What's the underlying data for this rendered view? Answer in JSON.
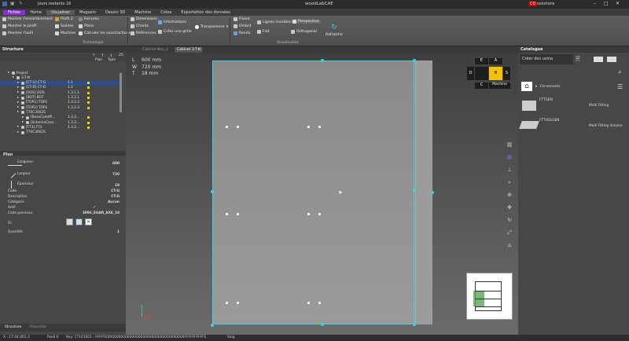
{
  "app": {
    "title": "woodLabCAE",
    "days_left": "Jours restants 16",
    "brand": "solutions",
    "brand_prefix": "CO"
  },
  "tabs": [
    "Fichier",
    "Home",
    "Visualiser",
    "Magasin",
    "Dessin 3D",
    "Machine",
    "Cotes",
    "Exportation des données"
  ],
  "ribbon": {
    "show_env": "Montrer l'encombrement",
    "show_profile": "Montrer le profil",
    "show_tool": "Montrer l'outil",
    "profil2": "Profil 2",
    "solides": "Solides",
    "machine": "Machine",
    "ferrures": "Ferrures",
    "plans": "Plans",
    "calc": "Calculer les soustractions",
    "group_tech": "Technologie",
    "dimensions": "Dimensions",
    "chants": "Chants",
    "references": "Références",
    "informations": "Informations",
    "creer_grille": "Créer une grille",
    "transparence": "Transparence",
    "filaire": "Filaire",
    "ombre": "Ombré",
    "rendu": "Rendu",
    "lignes_inv": "Lignes invisibles",
    "flat": "Flat",
    "perspective": "Perspective",
    "orthogonal": "Orthogonal",
    "group_vis": "Visualisation",
    "rafraichir": "Rafraîchir"
  },
  "structure": {
    "title": "Structure",
    "col_plan": "Plan",
    "col_type": "Type",
    "count": "25",
    "rows": [
      {
        "label": "Project",
        "plan": "",
        "indent": 0
      },
      {
        "label": "3-T-N",
        "plan": "",
        "indent": 1
      },
      {
        "label": "[CT-G] CT-G",
        "plan": "1.1",
        "indent": 2
      },
      {
        "label": "[CT-D] CT-D",
        "plan": "1.2",
        "indent": 2
      },
      {
        "label": "[DOS] DOS",
        "plan": "1.3.1.1",
        "indent": 2
      },
      {
        "label": "[BOT] BOT",
        "plan": "1.3.2.1",
        "indent": 2
      },
      {
        "label": "[TOP1] TOP1",
        "plan": "1.3.2.2",
        "indent": 2
      },
      {
        "label": "[TOP2] TOP2",
        "plan": "1.3.2.3",
        "indent": 2
      },
      {
        "label": "770C3002S",
        "plan": "",
        "indent": 2
      },
      {
        "label": "[BaseCoeeffi...",
        "plan": "1.3.2...",
        "indent": 3
      },
      {
        "label": "[SchemaCass...",
        "plan": "1.3.2...",
        "indent": 3
      },
      {
        "label": "[FT3] FT3",
        "plan": "1.3.2...",
        "indent": 2
      },
      {
        "label": "770C3002S",
        "plan": "",
        "indent": 2
      }
    ]
  },
  "properties": {
    "section": "Plan",
    "longueur": "Longueur",
    "longueur_val": "600",
    "largeur": "Largeur",
    "largeur_val": "720",
    "epaisseur": "Épaisseur",
    "epaisseur_val": "18",
    "code": "Code",
    "code_val": "CT-G",
    "description": "Description",
    "description_val": "CT-G",
    "categorie": "Catégorie",
    "categorie_val": "Aucun",
    "actif": "Actif",
    "actif_val": "✓",
    "code_panneau": "Code panneau",
    "code_panneau_val": "3096_EGAR_AXE_18",
    "fil": "Fil",
    "quantite": "Quantité",
    "quantite_val": "1"
  },
  "left_tabs": [
    "Structure",
    "Propriété"
  ],
  "viewport": {
    "tabs": [
      "Cabinet Neu_1",
      "Cabinet 3-T-N"
    ],
    "dims": [
      {
        "k": "L",
        "v": "600 mm"
      },
      {
        "k": "W",
        "v": "720 mm"
      },
      {
        "k": "T",
        "v": "18 mm"
      }
    ],
    "cube": {
      "e": "E",
      "a": "A",
      "d": "D",
      "b": "B",
      "s": "S",
      "c": "C",
      "machine": "Machine"
    }
  },
  "catalog": {
    "title": "Catalogue",
    "search": "Créer des usina",
    "breadcrumb": "Ferrements",
    "items": [
      {
        "name": "FTTGEN",
        "desc": "Multi Fitting"
      },
      {
        "name": "FTTVOLGEN",
        "desc": "Multi Fitting Volume"
      }
    ]
  },
  "status": {
    "coords": "X : 17.04.001.3",
    "pos": "Pos6 0",
    "key": "Key: 17101001 - FFFFFE00000000000000000000000000000000000FFFFFFFFFFE",
    "slog": "Slog"
  },
  "colors": {
    "accent": "#3fd0d8",
    "file_tab": "#8a2be2",
    "cube_yellow": "#f4c20d"
  }
}
